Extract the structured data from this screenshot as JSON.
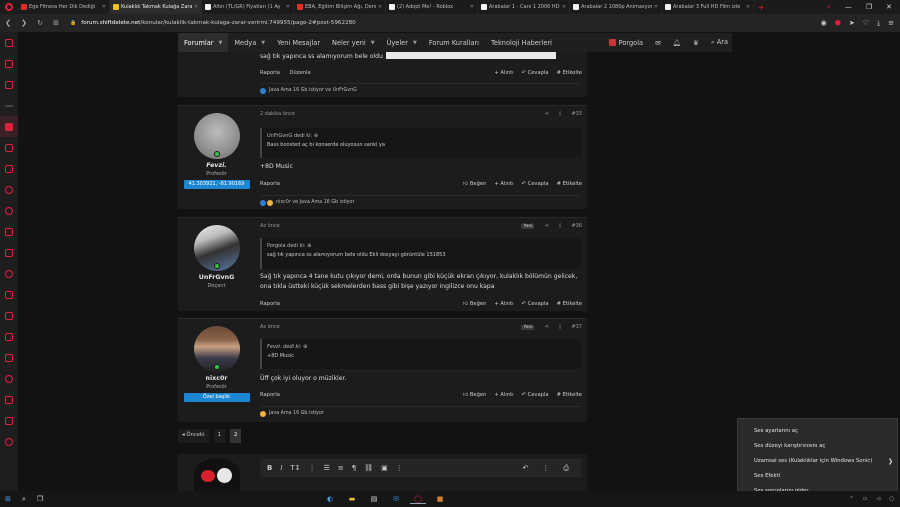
{
  "tabs": [
    {
      "label": "Ege Fitness Her Dik Dediği",
      "color": "#e52d27"
    },
    {
      "label": "Kulaklık Takmak Kulağa Zara",
      "color": "#f0c419",
      "active": true
    },
    {
      "label": "Altın (TL/GR) Fiyatları (1 Ay",
      "color": "#f2f2f2"
    },
    {
      "label": "EBA, Eğitim Bilişim Ağı, Dersl",
      "color": "#e52d27"
    },
    {
      "label": "(2) Adopt Me! - Roblox",
      "color": "#f2f2f2"
    },
    {
      "label": "Arabalar 1 - Cars 1 2006 HD",
      "color": "#f2f2f2"
    },
    {
      "label": "Arabalar 2 1080p Animasyon",
      "color": "#f2f2f2"
    },
    {
      "label": "Arabalar 3 Full HD Film izle",
      "color": "#f2f2f2"
    }
  ],
  "address": {
    "host": "forum.shiftdelete.net",
    "path": "/konular/kulaklik-takmak-kulaga-zarar-verirmi.749955/page-2#post-5962280"
  },
  "nav": {
    "items": [
      "Forumlar",
      "Medya",
      "Yeni Mesajlar",
      "Neler yeni",
      "Üyeler",
      "Forum Kuralları",
      "Teknoloji Haberleri"
    ],
    "user": "Porgola",
    "search": "Ara"
  },
  "top_post": {
    "text": "sağ tık yapınca ss alamıyorum bele oldu",
    "report": "Raporla",
    "edit": "Düzenle",
    "reply": "Alıntı",
    "quote": "Cevapla",
    "tag": "Etikelte",
    "reactions": "Java Ama 16 Gb istiyor ve UnFrGvnG"
  },
  "posts": [
    {
      "name": "Fevzi.",
      "role": "Profesör",
      "badge": "41.303921, -81.90169",
      "time": "2 dakika önce",
      "num": "#33",
      "new": "",
      "quote_author": "UnFrGvnG dedi ki:",
      "quote_text": "Bass boosted aç bi konserde oluyosun sanki ya",
      "message": "+8D Music",
      "report": "Raporla",
      "like": "Beğen",
      "reply": "Alıntı",
      "quote": "Cevapla",
      "tag": "Etikelte",
      "reactions": "nixc0r ve Java Ama 16 Gb istiyor"
    },
    {
      "name": "UnFrGvnG",
      "role": "Doçent",
      "badge": "",
      "time": "Az önce",
      "num": "#36",
      "new": "Yeni",
      "quote_author": "Porgola dedi ki:",
      "quote_text": "sağ tık yapınca ss alamıyorum bele oldu Ekli dosyayı görüntüle 151853",
      "message": "Sağ tık yapınca 4 tane kutu çıkıyor demi, orda bunun gibi küçük ekran çıkıyor, kulaklık bölümün gelicek, ona tıkla üstteki küçük sekmelerden bass gibi bişe yazıyor ingilizce onu kapa",
      "report": "Raporla",
      "like": "Beğen",
      "reply": "Alıntı",
      "quote": "Cevapla",
      "tag": "Etikelte",
      "reactions": ""
    },
    {
      "name": "nixc0r",
      "role": "Profesör",
      "badge": "Özel başlık",
      "time": "Az önce",
      "num": "#37",
      "new": "Yeni",
      "quote_author": "Fevzi. dedi ki:",
      "quote_text": "+8D Music",
      "message": "Üff çok iyi oluyor o müzikler.",
      "report": "Raporla",
      "like": "Beğen",
      "reply": "Alıntı",
      "quote": "Cevapla",
      "tag": "Etikelte",
      "reactions": "Java Ama 16 Gb istiyor"
    }
  ],
  "pagination": {
    "prev": "◂ Önceki",
    "pages": [
      "1",
      "2"
    ]
  },
  "context_menu": [
    "Ses ayarlarını aç",
    "Ses düzeyi karıştırıcısını aç",
    "Uzamsal ses (Kulaklıklar için Windows Sonic)",
    "Ses Efekti",
    "Ses sorunlarını gider"
  ]
}
